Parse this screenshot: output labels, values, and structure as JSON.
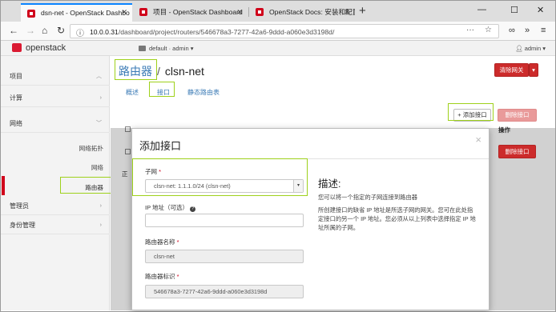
{
  "browser": {
    "tabs": [
      {
        "title": "dsn-net - OpenStack Dashbo",
        "active": true
      },
      {
        "title": "项目 - OpenStack Dashboard",
        "active": false
      },
      {
        "title": "OpenStack Docs: 安装和配置",
        "active": false
      }
    ],
    "url_prefix": "10.0.0.31",
    "url_path": "/dashboard/project/routers/546678a3-7277-42a6-9ddd-a060e3d3198d/",
    "url_dots": "···"
  },
  "topnav": {
    "logo_text": "openstack",
    "project_selector": "default · admin ▾",
    "user_menu": "admin ▾"
  },
  "sidebar": {
    "project": "项目",
    "compute": "计算",
    "network": "网络",
    "network_items": [
      "网络拓扑",
      "网络",
      "路由器"
    ],
    "admin": "管理员",
    "identity": "身份管理"
  },
  "page": {
    "breadcrumb_root": "路由器",
    "router_name": "clsn-net",
    "tabs": [
      "概述",
      "接口",
      "静态路由表"
    ],
    "clear_gateway_button": "清除网关",
    "add_interface_button": "+ 添加接口",
    "delete_interfaces_button": "删除接口",
    "actions_header": "操作",
    "row_delete_button": "删除接口",
    "partial_cell": "正"
  },
  "modal": {
    "title": "添加接口",
    "close": "×",
    "subnet_label": "子网",
    "subnet_value": "clsn-net: 1.1.1.0/24 (clsn-net)",
    "ip_label": "IP 地址（可选）",
    "router_name_label": "路由器名称",
    "router_name_value": "clsn-net",
    "router_id_label": "路由器标识",
    "router_id_value": "546678a3-7277-42a6-9ddd-a060e3d3198d",
    "description_title": "描述:",
    "description_line1": "您可以将一个指定的子网连接到路由器",
    "description_line2": "所创建接口的缺省 IP 地址是所选子网的网关。您可在此处指定接口的另一个 IP 地址。您必须从以上列表中选择指定 IP 地址所属的子网。"
  },
  "colors": {
    "accent_red": "#cc2b2b",
    "highlight_green": "#9ed11b",
    "link_blue": "#3a7ab5"
  }
}
